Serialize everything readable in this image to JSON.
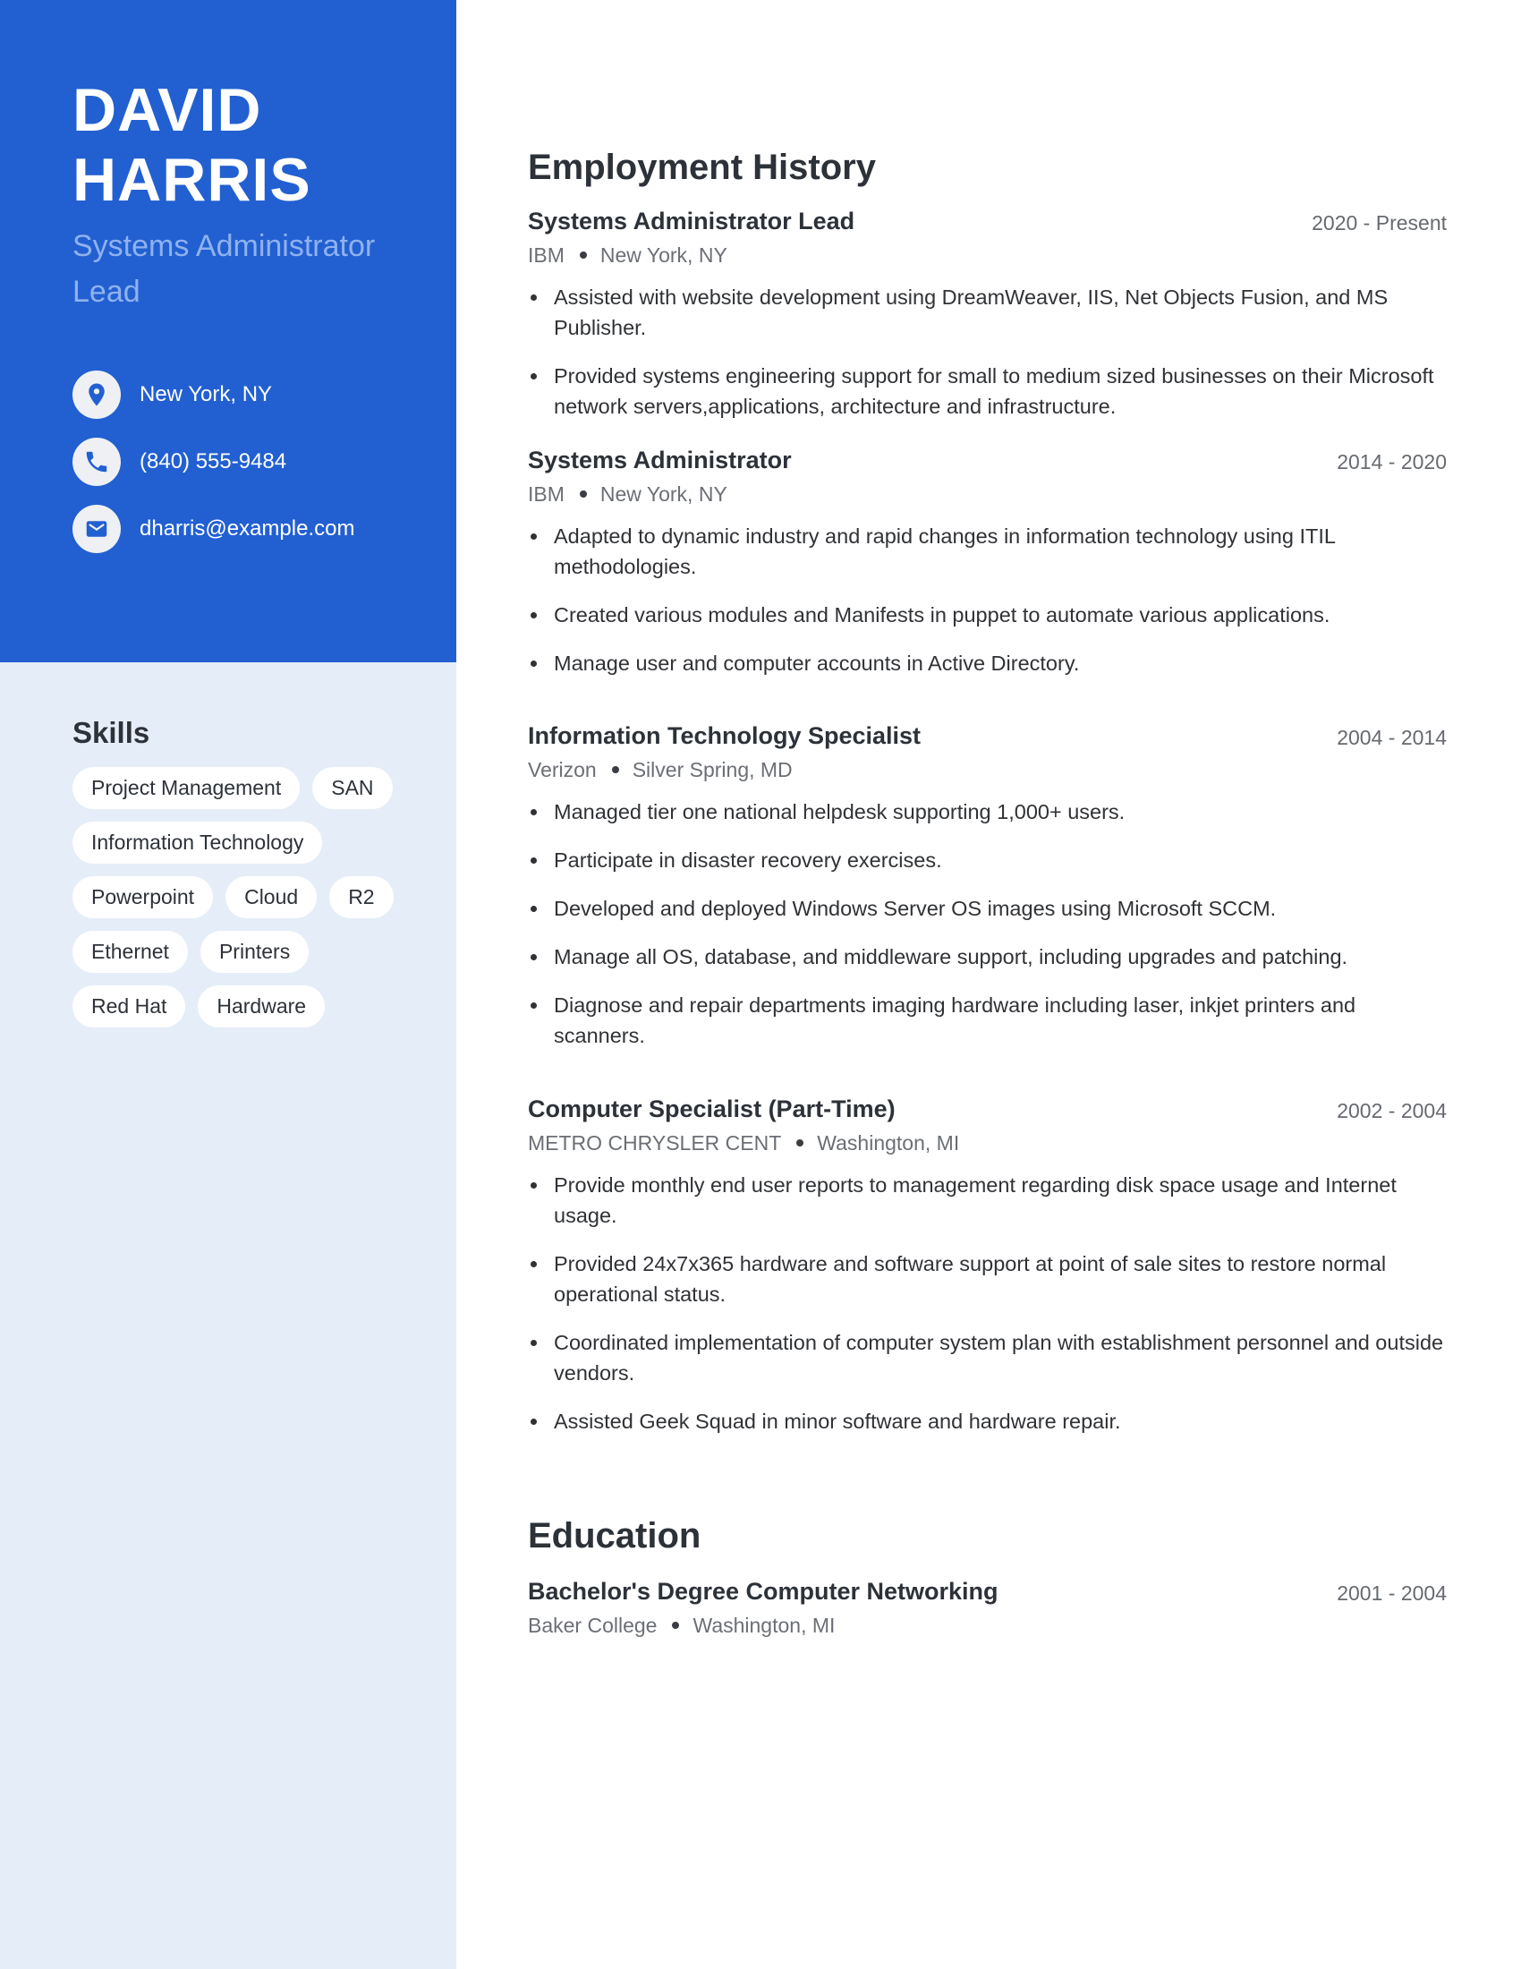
{
  "profile": {
    "first_name": "DAVID",
    "last_name": "HARRIS",
    "title": "Systems Administrator Lead"
  },
  "contact": [
    {
      "icon": "location-pin-icon",
      "text": "New York, NY"
    },
    {
      "icon": "phone-icon",
      "text": "(840) 555-9484"
    },
    {
      "icon": "mail-icon",
      "text": "dharris@example.com"
    }
  ],
  "skills": {
    "heading": "Skills",
    "items": [
      "Project Management",
      "SAN",
      "Information Technology",
      "Powerpoint",
      "Cloud",
      "R2",
      "Ethernet",
      "Printers",
      "Red Hat",
      "Hardware"
    ]
  },
  "employment": {
    "heading": "Employment History",
    "jobs": [
      {
        "title": "Systems Administrator Lead",
        "dates": "2020 - Present",
        "company": "IBM",
        "location": "New York, NY",
        "bullets": [
          "Assisted with website development using DreamWeaver, IIS, Net Objects Fusion, and MS Publisher.",
          "Provided systems engineering support for small to medium sized businesses on their Microsoft network servers,applications, architecture and infrastructure."
        ]
      },
      {
        "title": "Systems Administrator",
        "dates": "2014 - 2020",
        "company": "IBM",
        "location": "New York, NY",
        "bullets": [
          "Adapted to dynamic industry and rapid changes in information technology using ITIL methodologies.",
          "Created various modules and Manifests in puppet to automate various applications.",
          "Manage user and computer accounts in Active Directory."
        ]
      },
      {
        "title": "Information Technology Specialist",
        "dates": "2004 - 2014",
        "company": "Verizon",
        "location": "Silver Spring, MD",
        "bullets": [
          "Managed tier one national helpdesk supporting 1,000+ users.",
          "Participate in disaster recovery exercises.",
          "Developed and deployed Windows Server OS images using Microsoft SCCM.",
          "Manage all OS, database, and middleware support, including upgrades and patching.",
          "Diagnose and repair departments imaging hardware including laser, inkjet printers and scanners."
        ]
      },
      {
        "title": "Computer Specialist (Part-Time)",
        "dates": "2002 - 2004",
        "company": "METRO CHRYSLER CENT",
        "location": "Washington, MI",
        "bullets": [
          "Provide monthly end user reports to management regarding disk space usage and Internet usage.",
          "Provided 24x7x365 hardware and software support at point of sale sites to restore normal operational status.",
          "Coordinated implementation of computer system plan with establishment personnel and outside vendors.",
          "Assisted Geek Squad in minor software and hardware repair."
        ]
      }
    ]
  },
  "education": {
    "heading": "Education",
    "items": [
      {
        "title": "Bachelor's Degree Computer Networking",
        "dates": "2001 - 2004",
        "school": "Baker College",
        "location": "Washington, MI"
      }
    ]
  },
  "colors": {
    "accent": "#2260d1",
    "sidebar_bg": "#e5edf8",
    "subtitle": "#8fb2ef"
  }
}
